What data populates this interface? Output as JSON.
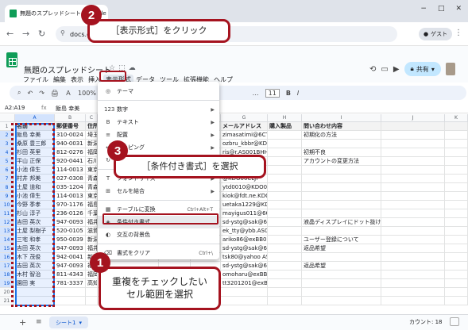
{
  "browser": {
    "tab_title": "無題のスプレッドシート - Google ...",
    "url": "docs.google.",
    "guest_label": "ゲスト",
    "window_controls": [
      "−",
      "□",
      "✕"
    ]
  },
  "docs": {
    "title": "無題のスプレッドシート",
    "menus": [
      "ファイル",
      "編集",
      "表示",
      "挿入",
      "表示形式",
      "データ",
      "ツール",
      "拡張機能",
      "ヘルプ"
    ],
    "share_label": "共有",
    "toolbar_items": [
      "↶",
      "↷",
      "🖨",
      "Ａ",
      "100%",
      "¥",
      "%",
      "…",
      "11",
      "B",
      "I"
    ]
  },
  "formula_bar": {
    "ref": "A2:A19",
    "fx": "fx",
    "value": "飯島 幸美"
  },
  "grid": {
    "columns": [
      "A",
      "B",
      "C",
      "",
      "",
      "",
      "G",
      "H",
      "I",
      "J",
      "K"
    ],
    "rows": [
      {
        "num": "1",
        "a": "名前",
        "b": "郵便番号",
        "c": "住所",
        "g": "メールアドレス",
        "h": "購入製品",
        "i": "問い合わせ内容",
        "header": true
      },
      {
        "num": "2",
        "a": "飯島 幸美",
        "b": "310-0024",
        "c": "埼玉",
        "g": "zimasatimi@6CTO1WWJPP",
        "h": "",
        "i": "初期化の方法"
      },
      {
        "num": "3",
        "a": "桑原 豊三郎",
        "b": "940-0031",
        "c": "新潟",
        "g": "ozbru_kbbr@KDO00CLJI",
        "h": "",
        "i": ""
      },
      {
        "num": "4",
        "a": "杉田 英里",
        "b": "812-0276",
        "c": "福岡",
        "g": "ris@r.AS001BHH",
        "h": "",
        "i": "初期不良"
      },
      {
        "num": "5",
        "a": "平山 正保",
        "b": "920-0441",
        "c": "石川",
        "g": "ri.AS001CJP",
        "h": "",
        "i": "アカウントの変更方法"
      },
      {
        "num": "6",
        "a": "小池 偉生",
        "b": "114-0013",
        "c": "東京",
        "g": "@KDO00CLJI",
        "h": "",
        "i": ""
      },
      {
        "num": "7",
        "a": "村井 邦美",
        "b": "027-0308",
        "c": "青森",
        "g": "@KDO00CLJI",
        "h": "",
        "i": ""
      },
      {
        "num": "8",
        "a": "土屋 道和",
        "b": "035-1204",
        "a2": "",
        "c": "青森",
        "g": "ytd0010@KDO00CLJI",
        "h": "",
        "i": ""
      },
      {
        "num": "9",
        "a": "小池 偉生",
        "b": "114-0013",
        "c": "東京",
        "g": "kiok@fdt.ne.KDO00CLJI",
        "h": "",
        "i": ""
      },
      {
        "num": "10",
        "a": "今野 季孝",
        "b": "970-1176",
        "c": "福島",
        "g": "uetaka1229@KDO00CLJI",
        "h": "",
        "i": ""
      },
      {
        "num": "11",
        "a": "杉山 淳子",
        "b": "236-0126",
        "c": "千葉",
        "g": "mayigus011@6CTO1WWJPP",
        "h": "",
        "i": ""
      },
      {
        "num": "12",
        "a": "吉田 英次",
        "b": "947-0093",
        "c": "福井",
        "g": "sd-ystg@sak@6CTO1WWJPP",
        "h": "",
        "i": "液晶ディスプレイにドット抜け"
      },
      {
        "num": "13",
        "a": "土屋 梨樹子",
        "b": "520-0105",
        "c": "滋賀",
        "g": "ek_tty@ybb.AS001CJP",
        "h": "",
        "i": ""
      },
      {
        "num": "14",
        "a": "三宅 和孝",
        "b": "950-0039",
        "c": "新潟",
        "g": "ariko86@exBB021FJP",
        "h": "",
        "i": "ユーザー登録について"
      },
      {
        "num": "15",
        "a": "吉田 英次",
        "b": "947-0093",
        "c": "福井",
        "g": "sd-ystg@sak@6CTO1WWJPP",
        "h": "",
        "i": "返品希望"
      },
      {
        "num": "16",
        "a": "木下 茂俊",
        "b": "942-0041",
        "c": "新潟",
        "g": "tsk80@yahoo AS001CJP",
        "h": "",
        "i": ""
      },
      {
        "num": "17",
        "a": "吉田 英次",
        "b": "947-0093",
        "c": "福井",
        "g": "sd-ystg@sak@6CTO1WWJPP",
        "h": "",
        "i": "返品希望"
      },
      {
        "num": "18",
        "a": "木村 智治",
        "b": "811-4343",
        "c": "福岡",
        "g": "omoharu@exBB021FJP",
        "h": "",
        "i": ""
      },
      {
        "num": "19",
        "a": "園田 実",
        "b": "781-3337",
        "c": "高知",
        "g": "tt3201201@exBB021FJP",
        "h": "",
        "i": ""
      },
      {
        "num": "20",
        "a": "",
        "b": "",
        "c": "",
        "g": "",
        "h": "",
        "i": ""
      },
      {
        "num": "21",
        "a": "",
        "b": "",
        "c": "",
        "g": "",
        "h": "",
        "i": ""
      }
    ]
  },
  "format_menu": {
    "items": [
      {
        "icon": "◎",
        "label": "テーマ",
        "shortcut": "",
        "arrow": false
      },
      {
        "sep": true
      },
      {
        "icon": "123",
        "label": "数字",
        "shortcut": "",
        "arrow": true
      },
      {
        "icon": "B",
        "label": "テキスト",
        "shortcut": "",
        "arrow": true
      },
      {
        "icon": "≡",
        "label": "配置",
        "shortcut": "",
        "arrow": true
      },
      {
        "icon": "↵",
        "label": "ラッピング",
        "shortcut": "",
        "arrow": true
      },
      {
        "icon": "↻",
        "label": "回転",
        "shortcut": "",
        "arrow": true
      },
      {
        "sep": true
      },
      {
        "icon": "T",
        "label": "フォントサイズ",
        "shortcut": "",
        "arrow": true
      },
      {
        "icon": "⊞",
        "label": "セルを結合",
        "shortcut": "",
        "arrow": true
      },
      {
        "sep": true
      },
      {
        "icon": "▦",
        "label": "テーブルに変換",
        "shortcut": "Ctrl+Alt+T",
        "arrow": false
      },
      {
        "icon": "◈",
        "label": "条件付き書式",
        "shortcut": "",
        "arrow": false
      },
      {
        "icon": "◐",
        "label": "交互の背景色",
        "shortcut": "",
        "arrow": false
      },
      {
        "sep": true
      },
      {
        "icon": "⌫",
        "label": "書式をクリア",
        "shortcut": "Ctrl+\\",
        "arrow": false
      }
    ]
  },
  "sheet_tabs": {
    "active": "シート1",
    "count": "カウント: 18"
  },
  "annotations": {
    "step1": {
      "num": "1",
      "text": "重複をチェックしたい\nセル範囲を選択"
    },
    "step2": {
      "num": "2",
      "text": "［表示形式］をクリック"
    },
    "step3": {
      "num": "3",
      "text": "［条件付き書式］を選択"
    }
  }
}
